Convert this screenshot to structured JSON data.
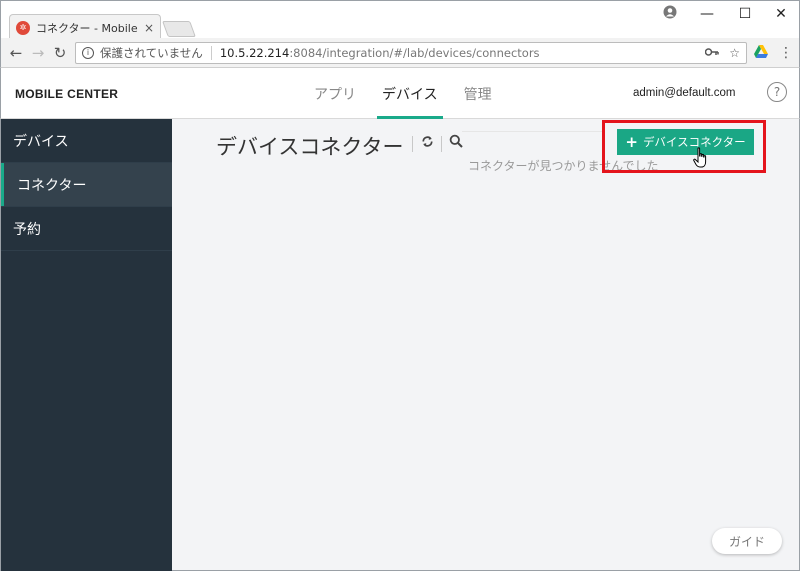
{
  "browser": {
    "tab_title": "コネクター - Mobile Center",
    "tab_close": "×",
    "security_label": "保護されていません",
    "url_host": "10.5.22.214",
    "url_rest": ":8084/integration/#/lab/devices/connectors",
    "window_controls": {
      "minimize": "—",
      "maximize": "☐",
      "close": "✕"
    }
  },
  "header": {
    "brand": "MOBILE CENTER",
    "tabs": [
      {
        "label": "アプリ",
        "active": false
      },
      {
        "label": "デバイス",
        "active": true
      },
      {
        "label": "管理",
        "active": false
      }
    ],
    "user": "admin@default.com",
    "help": "?"
  },
  "sidebar": {
    "items": [
      {
        "label": "デバイス",
        "active": false
      },
      {
        "label": "コネクター",
        "active": true
      },
      {
        "label": "予約",
        "active": false
      }
    ]
  },
  "main": {
    "title": "デバイスコネクター",
    "empty_message": "コネクターが見つかりませんでした",
    "add_button": {
      "plus": "+",
      "label": "デバイスコネクター"
    },
    "guide_button": "ガイド"
  },
  "colors": {
    "accent": "#1aa785",
    "sidebar_bg": "#25323d",
    "highlight": "#e4141c"
  }
}
